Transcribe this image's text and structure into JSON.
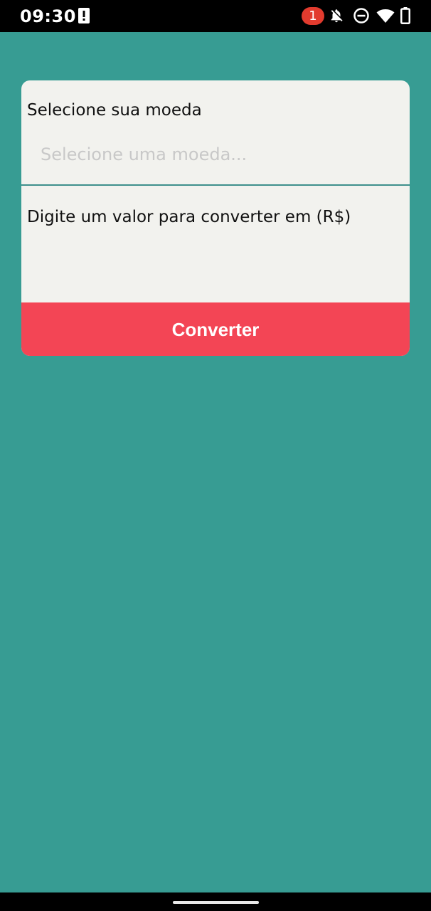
{
  "status_bar": {
    "time": "09:30",
    "notification_count": "1",
    "icons": [
      "alert-icon",
      "notifications-off-icon",
      "do-not-disturb-icon",
      "wifi-icon",
      "battery-icon"
    ]
  },
  "colors": {
    "background": "#379c93",
    "card": "#f2f2ee",
    "accent": "#3e8f8c",
    "button": "#f34555",
    "badge": "#e23b2e"
  },
  "form": {
    "currency_label": "Selecione sua moeda",
    "currency_placeholder": "Selecione uma moeda...",
    "value_label": "Digite um valor para converter em (R$)",
    "value_input": "",
    "convert_label": "Converter"
  }
}
